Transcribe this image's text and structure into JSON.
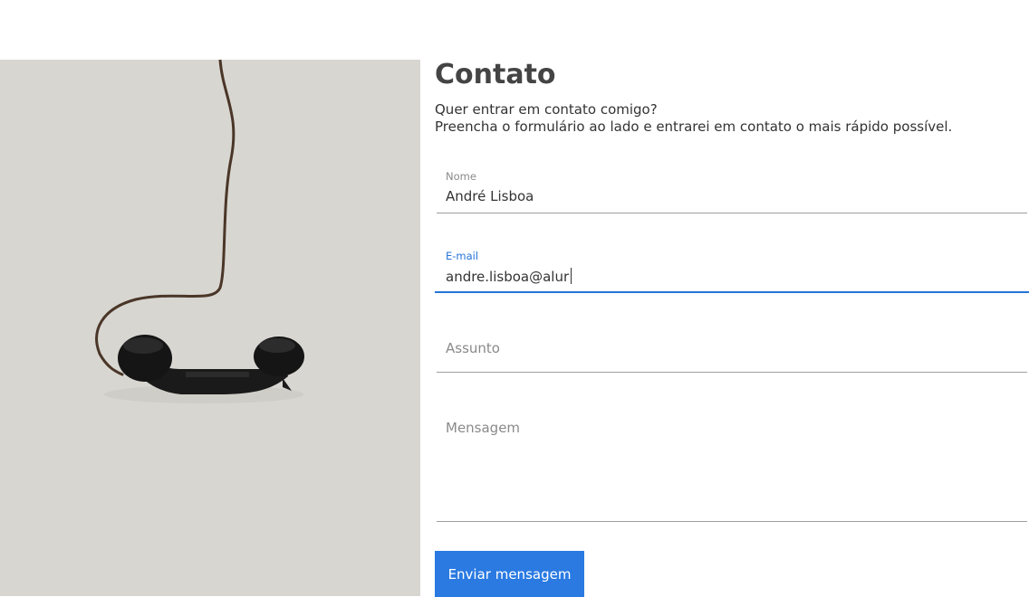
{
  "photo": {
    "alt": "telefone"
  },
  "contact": {
    "title": "Contato",
    "intro_line1": "Quer entrar em contato comigo?",
    "intro_line2": "Preencha o formulário ao lado e entrarei em contato o mais rápido possível."
  },
  "form": {
    "name": {
      "label": "Nome",
      "value": "André Lisboa"
    },
    "email": {
      "label": "E-mail",
      "value": "andre.lisboa@alur"
    },
    "subject": {
      "placeholder": "Assunto"
    },
    "message": {
      "placeholder": "Mensagem"
    },
    "submit_label": "Enviar mensagem"
  },
  "colors": {
    "accent": "#2a7ae2",
    "photo_background": "#d8d6d1"
  }
}
